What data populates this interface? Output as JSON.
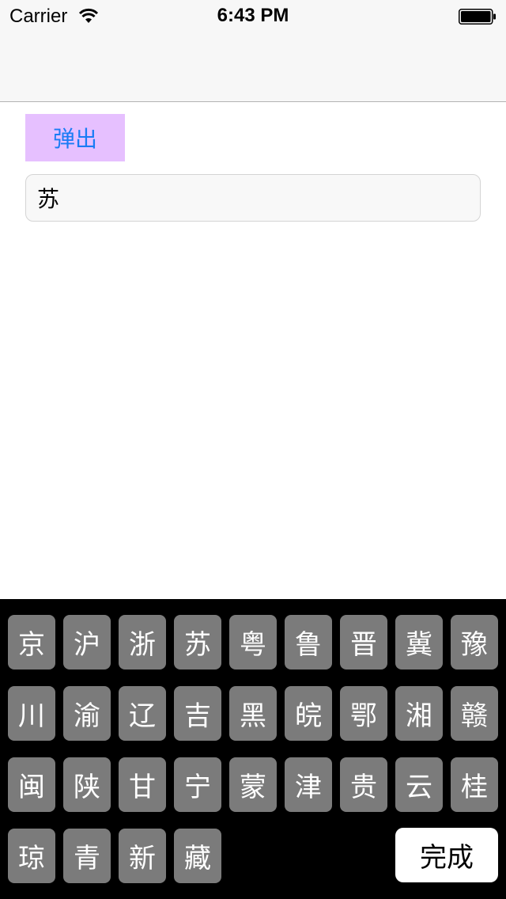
{
  "status_bar": {
    "carrier": "Carrier",
    "time": "6:43 PM",
    "wifi_icon": "wifi-icon",
    "battery_icon": "battery-full-icon"
  },
  "main": {
    "pop_button_label": "弹出",
    "text_field_value": "苏",
    "pop_button_bg": "#e6c0ff",
    "pop_button_text_color": "#1a7cf5"
  },
  "keyboard": {
    "rows": [
      [
        "京",
        "沪",
        "浙",
        "苏",
        "粤",
        "鲁",
        "晋",
        "冀",
        "豫"
      ],
      [
        "川",
        "渝",
        "辽",
        "吉",
        "黑",
        "皖",
        "鄂",
        "湘",
        "赣"
      ],
      [
        "闽",
        "陕",
        "甘",
        "宁",
        "蒙",
        "津",
        "贵",
        "云",
        "桂"
      ],
      [
        "琼",
        "青",
        "新",
        "藏"
      ]
    ],
    "done_label": "完成",
    "key_bg": "#7b7b7b",
    "background": "#000000"
  }
}
